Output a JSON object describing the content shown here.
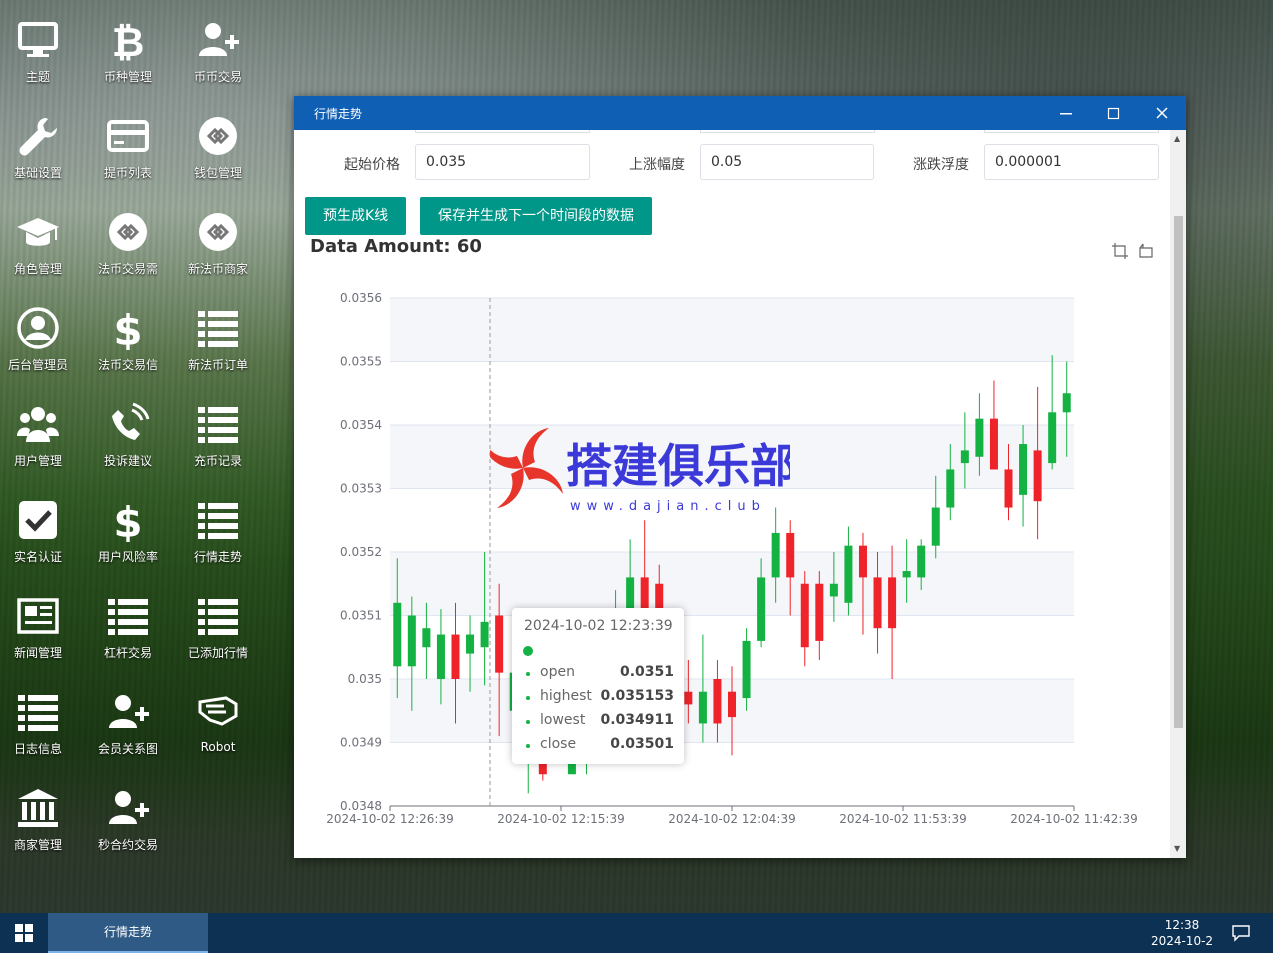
{
  "desktop": {
    "icons": [
      {
        "label": "主题",
        "icon": "monitor-icon"
      },
      {
        "label": "币种管理",
        "icon": "bitcoin-icon"
      },
      {
        "label": "币币交易",
        "icon": "user-plus-icon"
      },
      {
        "label": "基础设置",
        "icon": "wrench-icon"
      },
      {
        "label": "提币列表",
        "icon": "credit-card-icon"
      },
      {
        "label": "钱包管理",
        "icon": "exchange-circle-icon"
      },
      {
        "label": "角色管理",
        "icon": "graduation-cap-icon"
      },
      {
        "label": "法币交易需",
        "icon": "exchange-circle-icon"
      },
      {
        "label": "新法币商家",
        "icon": "exchange-circle-icon"
      },
      {
        "label": "后台管理员",
        "icon": "user-circle-icon"
      },
      {
        "label": "法币交易信",
        "icon": "dollar-icon"
      },
      {
        "label": "新法币订单",
        "icon": "list-icon"
      },
      {
        "label": "用户管理",
        "icon": "users-icon"
      },
      {
        "label": "投诉建议",
        "icon": "phone-volume-icon"
      },
      {
        "label": "充币记录",
        "icon": "list-icon"
      },
      {
        "label": "实名认证",
        "icon": "check-square-icon"
      },
      {
        "label": "用户风险率",
        "icon": "dollar-icon"
      },
      {
        "label": "行情走势",
        "icon": "list-icon"
      },
      {
        "label": "新闻管理",
        "icon": "newspaper-icon"
      },
      {
        "label": "杠杆交易",
        "icon": "list-icon"
      },
      {
        "label": "已添加行情",
        "icon": "list-icon"
      },
      {
        "label": "日志信息",
        "icon": "list-icon"
      },
      {
        "label": "会员关系图",
        "icon": "user-plus-icon"
      },
      {
        "label": "Robot",
        "icon": "robot-hand-icon"
      },
      {
        "label": "商家管理",
        "icon": "bank-icon"
      },
      {
        "label": "秒合约交易",
        "icon": "user-plus-icon"
      }
    ]
  },
  "window": {
    "title": "行情走势",
    "form": {
      "start_price_label": "起始价格",
      "start_price_value": "0.035",
      "rise_label": "上涨幅度",
      "rise_value": "0.05",
      "float_label": "涨跌浮度",
      "float_value": "0.000001"
    },
    "buttons": {
      "generate": "预生成K线",
      "save_next": "保存并生成下一个时间段的数据"
    },
    "amount_label": "Data Amount: 60",
    "watermark": {
      "text": "搭建俱乐部",
      "url": "www.dajian.club"
    }
  },
  "colors": {
    "up": "#14b143",
    "down": "#ef232a",
    "titlebar": "#0f5fb5",
    "button": "#009688",
    "taskbar": "#0d3153"
  },
  "chart_data": {
    "type": "candlestick",
    "title": "",
    "ylim": [
      0.0348,
      0.0356
    ],
    "y_ticks": [
      "0.0356",
      "0.0355",
      "0.0354",
      "0.0353",
      "0.0352",
      "0.0351",
      "0.035",
      "0.0349",
      "0.0348"
    ],
    "x_ticks": [
      "2024-10-02 12:26:39",
      "2024-10-02 12:15:39",
      "2024-10-02 12:04:39",
      "2024-10-02 11:53:39",
      "2024-10-02 11:42:39"
    ],
    "candles": [
      {
        "o": 0.03502,
        "c": 0.03512,
        "h": 0.03519,
        "l": 0.03497
      },
      {
        "o": 0.03502,
        "c": 0.0351,
        "h": 0.03513,
        "l": 0.03495
      },
      {
        "o": 0.03505,
        "c": 0.03508,
        "h": 0.03512,
        "l": 0.035
      },
      {
        "o": 0.035,
        "c": 0.03507,
        "h": 0.03511,
        "l": 0.03496
      },
      {
        "o": 0.03507,
        "c": 0.035,
        "h": 0.03512,
        "l": 0.03493
      },
      {
        "o": 0.03504,
        "c": 0.03507,
        "h": 0.0351,
        "l": 0.03498
      },
      {
        "o": 0.03505,
        "c": 0.03509,
        "h": 0.0352,
        "l": 0.03499
      },
      {
        "o": 0.0351,
        "c": 0.03501,
        "h": 0.03515,
        "l": 0.03491
      },
      {
        "o": 0.03495,
        "c": 0.03501,
        "h": 0.03504,
        "l": 0.03493
      },
      {
        "o": 0.03488,
        "c": 0.0349,
        "h": 0.03492,
        "l": 0.03482
      },
      {
        "o": 0.0349,
        "c": 0.03485,
        "h": 0.03495,
        "l": 0.03484
      },
      {
        "o": 0.0349,
        "c": 0.03489,
        "h": 0.03495,
        "l": 0.03487
      },
      {
        "o": 0.03485,
        "c": 0.0349,
        "h": 0.03493,
        "l": 0.03485
      },
      {
        "o": 0.03488,
        "c": 0.03494,
        "h": 0.03499,
        "l": 0.03485
      },
      {
        "o": 0.03495,
        "c": 0.03503,
        "h": 0.03507,
        "l": 0.03492
      },
      {
        "o": 0.03503,
        "c": 0.03509,
        "h": 0.03514,
        "l": 0.035
      },
      {
        "o": 0.0351,
        "c": 0.03516,
        "h": 0.03522,
        "l": 0.03505
      },
      {
        "o": 0.03516,
        "c": 0.03511,
        "h": 0.03525,
        "l": 0.03507
      },
      {
        "o": 0.03515,
        "c": 0.03508,
        "h": 0.03518,
        "l": 0.03505
      },
      {
        "o": 0.03506,
        "c": 0.03498,
        "h": 0.03508,
        "l": 0.03495
      },
      {
        "o": 0.03498,
        "c": 0.03496,
        "h": 0.03503,
        "l": 0.03493
      },
      {
        "o": 0.03493,
        "c": 0.03498,
        "h": 0.03507,
        "l": 0.0349
      },
      {
        "o": 0.035,
        "c": 0.03493,
        "h": 0.03503,
        "l": 0.0349
      },
      {
        "o": 0.03498,
        "c": 0.03494,
        "h": 0.03502,
        "l": 0.03488
      },
      {
        "o": 0.03497,
        "c": 0.03506,
        "h": 0.03508,
        "l": 0.03495
      },
      {
        "o": 0.03506,
        "c": 0.03516,
        "h": 0.03519,
        "l": 0.03505
      },
      {
        "o": 0.03516,
        "c": 0.03523,
        "h": 0.03527,
        "l": 0.03512
      },
      {
        "o": 0.03523,
        "c": 0.03516,
        "h": 0.03525,
        "l": 0.0351
      },
      {
        "o": 0.03515,
        "c": 0.03505,
        "h": 0.03517,
        "l": 0.03502
      },
      {
        "o": 0.03515,
        "c": 0.03506,
        "h": 0.03517,
        "l": 0.03503
      },
      {
        "o": 0.03513,
        "c": 0.03515,
        "h": 0.0352,
        "l": 0.03509
      },
      {
        "o": 0.03512,
        "c": 0.03521,
        "h": 0.03524,
        "l": 0.0351
      },
      {
        "o": 0.03521,
        "c": 0.03516,
        "h": 0.03523,
        "l": 0.03507
      },
      {
        "o": 0.03516,
        "c": 0.03508,
        "h": 0.0352,
        "l": 0.03504
      },
      {
        "o": 0.03516,
        "c": 0.03508,
        "h": 0.03521,
        "l": 0.035
      },
      {
        "o": 0.03516,
        "c": 0.03517,
        "h": 0.03522,
        "l": 0.03512
      },
      {
        "o": 0.03516,
        "c": 0.03521,
        "h": 0.03522,
        "l": 0.03514
      },
      {
        "o": 0.03521,
        "c": 0.03527,
        "h": 0.03532,
        "l": 0.03519
      },
      {
        "o": 0.03527,
        "c": 0.03533,
        "h": 0.03537,
        "l": 0.03525
      },
      {
        "o": 0.03534,
        "c": 0.03536,
        "h": 0.03542,
        "l": 0.0353
      },
      {
        "o": 0.03535,
        "c": 0.03541,
        "h": 0.03545,
        "l": 0.03532
      },
      {
        "o": 0.03541,
        "c": 0.03533,
        "h": 0.03547,
        "l": 0.03533
      },
      {
        "o": 0.03533,
        "c": 0.03527,
        "h": 0.03537,
        "l": 0.03525
      },
      {
        "o": 0.03529,
        "c": 0.03537,
        "h": 0.0354,
        "l": 0.03524
      },
      {
        "o": 0.03536,
        "c": 0.03528,
        "h": 0.03546,
        "l": 0.03522
      },
      {
        "o": 0.03534,
        "c": 0.03542,
        "h": 0.03551,
        "l": 0.03533
      },
      {
        "o": 0.03542,
        "c": 0.03545,
        "h": 0.0355,
        "l": 0.03535
      }
    ],
    "tooltip": {
      "time": "2024-10-02 12:23:39",
      "rows": [
        {
          "k": "open",
          "v": "0.0351"
        },
        {
          "k": "highest",
          "v": "0.035153"
        },
        {
          "k": "lowest",
          "v": "0.034911"
        },
        {
          "k": "close",
          "v": "0.03501"
        }
      ]
    }
  },
  "taskbar": {
    "task_label": "行情走势",
    "time": "12:38",
    "date": "2024-10-2"
  }
}
